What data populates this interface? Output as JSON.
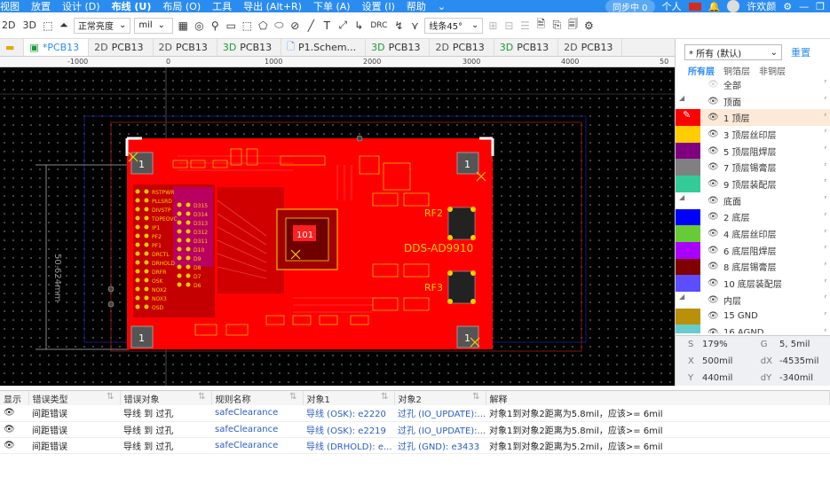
{
  "menu": {
    "items": [
      "视图",
      "放置",
      "设计 (D)",
      "布线 (U)",
      "布局 (O)",
      "工具",
      "导出 (Alt+R)",
      "下单 (A)",
      "设置 (I)",
      "帮助"
    ],
    "sync_label": "同步中 0",
    "personal_label": "个人",
    "user_name": "许欢颜"
  },
  "toolbar": {
    "view_2d": "2D",
    "view_3d": "3D",
    "brightness": "正常亮度",
    "unit": "mil",
    "line_angle": "线条45°",
    "text_tool": "T",
    "drc_tool": "DRC"
  },
  "tabs": [
    {
      "prefix": "",
      "name": "*PCB13",
      "active": true
    },
    {
      "prefix": "2D",
      "name": "PCB13",
      "active": false
    },
    {
      "prefix": "2D",
      "name": "PCB13",
      "active": false
    },
    {
      "prefix": "3D",
      "name": "PCB13",
      "active": false
    },
    {
      "prefix": "",
      "name": "P1.Schem...",
      "active": false
    },
    {
      "prefix": "3D",
      "name": "PCB13",
      "active": false
    },
    {
      "prefix": "2D",
      "name": "PCB13",
      "active": false
    },
    {
      "prefix": "3D",
      "name": "PCB13",
      "active": false
    },
    {
      "prefix": "2D",
      "name": "PCB13",
      "active": false
    }
  ],
  "ruler": [
    "-1000",
    "0",
    "1000",
    "2000",
    "3000",
    "4000",
    "50"
  ],
  "board": {
    "dimension_label": "50.624mm",
    "chip_label": "101",
    "product_label": "DDS-AD9910",
    "rf_labels": [
      "RF2",
      "RF3"
    ],
    "corner_marks": [
      "1",
      "1",
      "1",
      "1"
    ],
    "header_pins": [
      "RSTPWR",
      "PLLSRD",
      "DIVSTP",
      "TOPEOVC",
      "IP1",
      "PF2",
      "PF1",
      "DRCTL",
      "DRHOLD",
      "DRFR",
      "OSK",
      "NOX2",
      "NOX3",
      "OSD"
    ],
    "data_pins": [
      "D315",
      "D314",
      "D313",
      "D312",
      "D311",
      "D10",
      "D9",
      "D8",
      "D7",
      "D6",
      "D5",
      "D4",
      "D3",
      "D2",
      "D1",
      "D0"
    ]
  },
  "layers_panel": {
    "filter_select": "* 所有 (默认)",
    "reset_button": "重置",
    "tabs": [
      "所有层",
      "铜箔层",
      "非铜层"
    ],
    "rows": [
      {
        "type": "all",
        "label": "全部",
        "color": ""
      },
      {
        "type": "group",
        "label": "顶面",
        "color": ""
      },
      {
        "type": "layer",
        "label": "1 顶层",
        "color": "#ff0000",
        "selected": true
      },
      {
        "type": "layer",
        "label": "3 顶层丝印层",
        "color": "#ffcc00"
      },
      {
        "type": "layer",
        "label": "5 顶层阻焊层",
        "color": "#800080"
      },
      {
        "type": "layer",
        "label": "7 顶层锡膏层",
        "color": "#808080"
      },
      {
        "type": "layer",
        "label": "9 顶层装配层",
        "color": "#33cc99"
      },
      {
        "type": "group",
        "label": "底面",
        "color": ""
      },
      {
        "type": "layer",
        "label": "2 底层",
        "color": "#0000ff"
      },
      {
        "type": "layer",
        "label": "4 底层丝印层",
        "color": "#66cc33"
      },
      {
        "type": "layer",
        "label": "6 底层阻焊层",
        "color": "#aa00ff"
      },
      {
        "type": "layer",
        "label": "8 底层锡膏层",
        "color": "#800000"
      },
      {
        "type": "layer",
        "label": "10 底层装配层",
        "color": "#5c4dff"
      },
      {
        "type": "group",
        "label": "内层",
        "color": ""
      },
      {
        "type": "layer",
        "label": "15 GND",
        "color": "#b8900a"
      },
      {
        "type": "layer",
        "label": "16 AGND",
        "color": "#66cccc"
      }
    ]
  },
  "coords": {
    "s_label": "S",
    "s_value": "179%",
    "g_label": "G",
    "g_value": "5, 5mil",
    "x_label": "X",
    "x_value": "500mil",
    "dx_label": "dX",
    "dx_value": "-4535mil",
    "y_label": "Y",
    "y_value": "440mil",
    "dy_label": "dY",
    "dy_value": "-340mil"
  },
  "drc_table": {
    "headers": [
      "显示",
      "错误类型",
      "错误对象",
      "规则名称",
      "对象1",
      "对象2",
      "解释"
    ],
    "rows": [
      {
        "type": "间距错误",
        "object": "导线 到 过孔",
        "rule": "safeClearance",
        "obj1": "导线 (OSK): e2220",
        "obj2": "过孔 (IO_UPDATE):...",
        "desc": "对象1到对象2距离为5.8mil，应该>= 6mil"
      },
      {
        "type": "间距错误",
        "object": "导线 到 过孔",
        "rule": "safeClearance",
        "obj1": "导线 (OSK): e2219",
        "obj2": "过孔 (IO_UPDATE):...",
        "desc": "对象1到对象2距离为5.8mil，应该>= 6mil"
      },
      {
        "type": "间距错误",
        "object": "导线 到 过孔",
        "rule": "safeClearance",
        "obj1": "导线 (DRHOLD): e...",
        "obj2": "过孔 (GND): e3433",
        "desc": "对象1到对象2距离为5.2mil，应该>= 6mil"
      }
    ]
  }
}
